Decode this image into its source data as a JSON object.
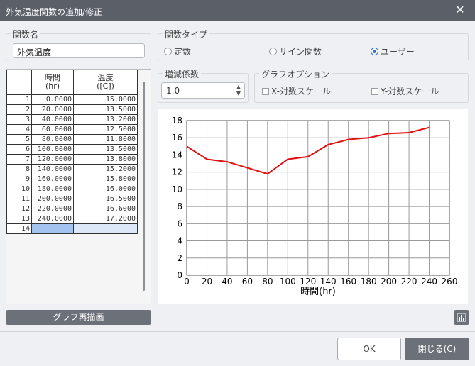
{
  "window": {
    "title": "外気温度関数の追加/修正",
    "close_glyph": "✕"
  },
  "func_name": {
    "legend": "関数名",
    "value": "外気温度"
  },
  "func_type": {
    "legend": "関数タイプ",
    "options": [
      "定数",
      "サイン関数",
      "ユーザー"
    ],
    "selected": "ユーザー"
  },
  "factor": {
    "legend": "増減係数",
    "value": "1.0"
  },
  "graph_options": {
    "legend": "グラフオプション",
    "x_log": "X-対数スケール",
    "y_log": "Y-対数スケール"
  },
  "table": {
    "col_time": "時間",
    "col_time_unit": "(hr)",
    "col_temp": "温度",
    "col_temp_unit": "([C])",
    "rows": [
      [
        "1",
        "0.0000",
        "15.0000"
      ],
      [
        "2",
        "20.0000",
        "13.5000"
      ],
      [
        "3",
        "40.0000",
        "13.2000"
      ],
      [
        "4",
        "60.0000",
        "12.5000"
      ],
      [
        "5",
        "80.0000",
        "11.8000"
      ],
      [
        "6",
        "100.0000",
        "13.5000"
      ],
      [
        "7",
        "120.0000",
        "13.8000"
      ],
      [
        "8",
        "140.0000",
        "15.2000"
      ],
      [
        "9",
        "160.0000",
        "15.8000"
      ],
      [
        "10",
        "180.0000",
        "16.0000"
      ],
      [
        "11",
        "200.0000",
        "16.5000"
      ],
      [
        "12",
        "220.0000",
        "16.6000"
      ],
      [
        "13",
        "240.0000",
        "17.2000"
      ],
      [
        "14",
        "",
        ""
      ]
    ]
  },
  "buttons": {
    "redraw": "グラフ再描画",
    "ok": "OK",
    "close": "閉じる(C)"
  },
  "colors": {
    "series": "#e01010",
    "titlebar": "#5b6068",
    "accent": "#2f6fd6"
  },
  "chart_data": {
    "type": "line",
    "xlabel": "時間(hr)",
    "ylabel": "",
    "xlim": [
      0,
      260
    ],
    "ylim": [
      0,
      18
    ],
    "xticks": [
      0,
      20,
      40,
      60,
      80,
      100,
      120,
      140,
      160,
      180,
      200,
      220,
      240,
      260
    ],
    "yticks": [
      0,
      2,
      4,
      6,
      8,
      10,
      12,
      14,
      16,
      18
    ],
    "grid": true,
    "series": [
      {
        "x": [
          0,
          20,
          40,
          60,
          80,
          100,
          120,
          140,
          160,
          180,
          200,
          220,
          240
        ],
        "y": [
          15.0,
          13.5,
          13.2,
          12.5,
          11.8,
          13.5,
          13.8,
          15.2,
          15.8,
          16.0,
          16.5,
          16.6,
          17.2
        ]
      }
    ]
  }
}
